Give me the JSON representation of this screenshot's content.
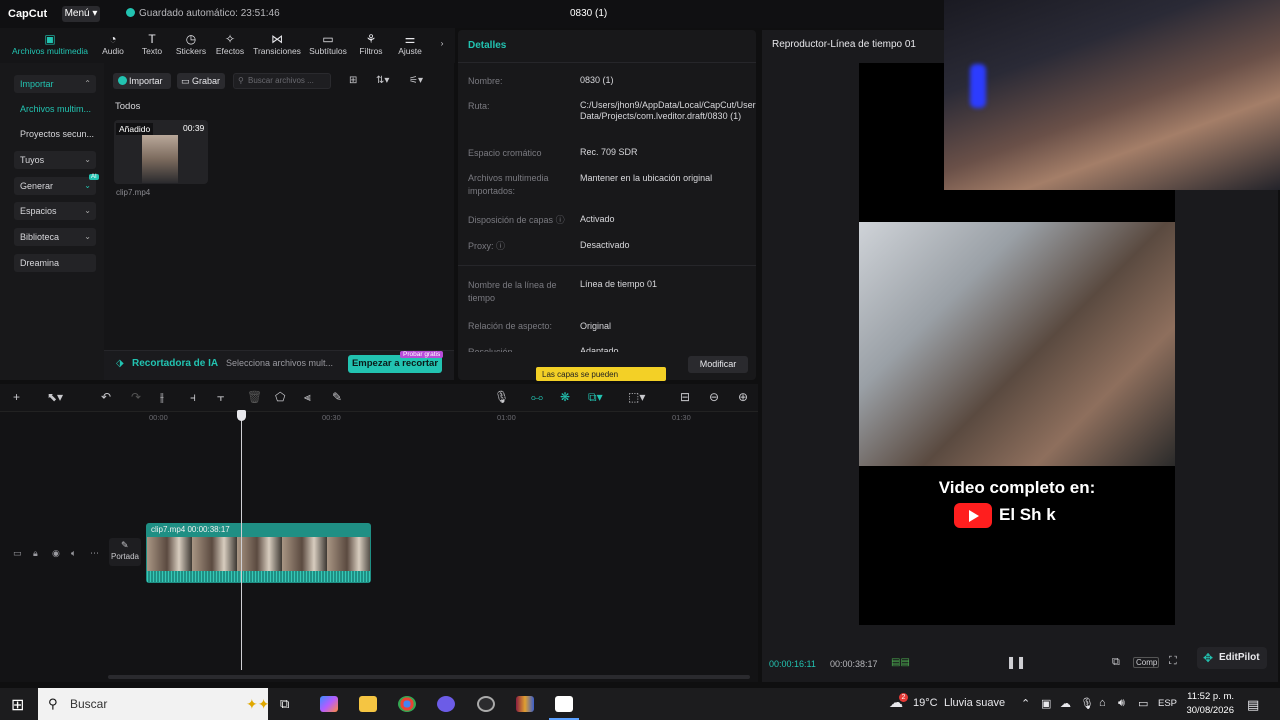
{
  "titlebar": {
    "logo": "CapCut",
    "menu": "Menú",
    "autosave": "Guardado automático: 23:51:46",
    "project_title": "0830 (1)"
  },
  "tooltabs": [
    {
      "label": "Archivos multimedia",
      "icon": "media-icon"
    },
    {
      "label": "Audio",
      "icon": "audio-icon"
    },
    {
      "label": "Texto",
      "icon": "text-icon"
    },
    {
      "label": "Stickers",
      "icon": "stickers-icon"
    },
    {
      "label": "Efectos",
      "icon": "effects-icon"
    },
    {
      "label": "Transiciones",
      "icon": "transitions-icon"
    },
    {
      "label": "Subtítulos",
      "icon": "subtitles-icon"
    },
    {
      "label": "Filtros",
      "icon": "filters-icon"
    },
    {
      "label": "Ajuste",
      "icon": "adjust-icon"
    }
  ],
  "leftnav": {
    "items": [
      "Importar",
      "Archivos multim...",
      "Proyectos secun...",
      "Tuyos",
      "Generar",
      "Espacios",
      "Biblioteca",
      "Dreamina"
    ],
    "generar_badge": "AI"
  },
  "media": {
    "import_label": "Importar",
    "record_label": "Grabar",
    "search_placeholder": "Buscar archivos ...",
    "section": "Todos",
    "clip": {
      "tag": "Añadido",
      "duration": "00:39",
      "name": "clip7.mp4"
    }
  },
  "aibar": {
    "title": "Recortadora de IA",
    "hint": "Selecciona archivos mult...",
    "button": "Empezar a recortar",
    "badge": "Probar gratis"
  },
  "details": {
    "header": "Detalles",
    "rows": [
      {
        "label": "Nombre:",
        "value": "0830 (1)"
      },
      {
        "label": "Ruta:",
        "value": "C:/Users/jhon9/AppData/Local/CapCut/User Data/Projects/com.lveditor.draft/0830 (1)"
      },
      {
        "label": "Espacio cromático",
        "value": "Rec. 709 SDR"
      },
      {
        "label": "Archivos multimedia importados:",
        "value": "Mantener en la ubicación original"
      },
      {
        "label": "Disposición de capas",
        "value": "Activado"
      },
      {
        "label": "Proxy:",
        "value": "Desactivado"
      },
      {
        "label": "Nombre de la línea de tiempo",
        "value": "Línea de tiempo 01"
      },
      {
        "label": "Relación de aspecto:",
        "value": "Original"
      },
      {
        "label": "Resolución",
        "value": "Adaptado"
      }
    ],
    "modify": "Modificar",
    "tooltip": "Las capas se pueden"
  },
  "player": {
    "header": "Reproductor-Línea de tiempo 01",
    "overlay_text": "Video completo en:",
    "channel": "El Sh k",
    "current_time": "00:00:16:11",
    "total_time": "00:00:38:17",
    "compare_label": "Comp",
    "editpilot": "EditPilot"
  },
  "timeline": {
    "marks": [
      "00:00",
      "00:30",
      "01:00",
      "01:30"
    ],
    "clip_label": "clip7.mp4  00:00:38:17",
    "cover": "Portada"
  },
  "taskbar": {
    "search": "Buscar",
    "weather_temp": "19°C",
    "weather_text": "Lluvia suave",
    "lang": "ESP",
    "time": "11:52 p. m.",
    "date": "30/08/2026",
    "weather_badge": "2"
  },
  "colors": {
    "accent": "#22c3b1",
    "tooltip": "#f3d026",
    "youtube": "#ff1e1e"
  }
}
